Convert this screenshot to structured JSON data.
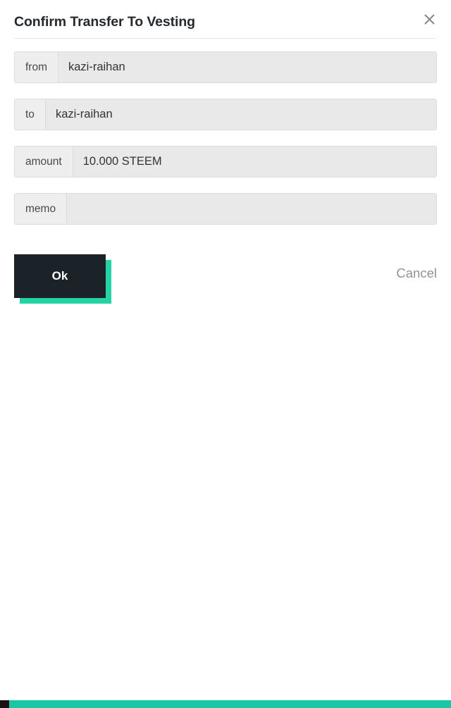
{
  "dialog": {
    "title": "Confirm Transfer To Vesting",
    "close_icon": "close-icon"
  },
  "fields": [
    {
      "label": "from",
      "value": "kazi-raihan",
      "placeholder": ""
    },
    {
      "label": "to",
      "value": "kazi-raihan",
      "placeholder": ""
    },
    {
      "label": "amount",
      "value": "10.000 STEEM",
      "placeholder": ""
    },
    {
      "label": "memo",
      "value": "",
      "placeholder": ""
    }
  ],
  "actions": {
    "ok_label": "Ok",
    "cancel_label": "Cancel"
  },
  "colors": {
    "accent_teal": "#19c7a4",
    "button_dark": "#1b2228",
    "field_bg": "#e9e9e9",
    "label_bg": "#eeeeee",
    "title_text": "#24292e",
    "cancel_text": "#8c9298"
  }
}
